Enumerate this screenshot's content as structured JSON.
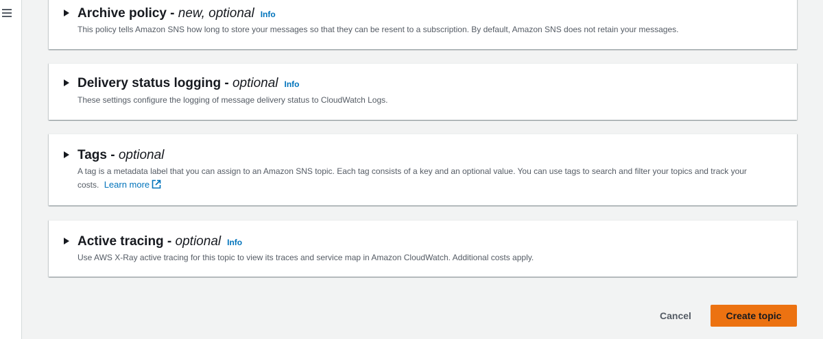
{
  "nav": {
    "menu_icon": "hamburger-menu-icon"
  },
  "sections": [
    {
      "title": "Archive policy",
      "separator": " - ",
      "qualifier": "new, optional",
      "info": "Info",
      "description": "This policy tells Amazon SNS how long to store your messages so that they can be resent to a subscription. By default, Amazon SNS does not retain your messages."
    },
    {
      "title": "Delivery status logging",
      "separator": " - ",
      "qualifier": "optional",
      "info": "Info",
      "description": "These settings configure the logging of message delivery status to CloudWatch Logs."
    },
    {
      "title": "Tags",
      "separator": " - ",
      "qualifier": "optional",
      "description": "A tag is a metadata label that you can assign to an Amazon SNS topic. Each tag consists of a key and an optional value. You can use tags to search and filter your topics and track your costs.",
      "learn_more": "Learn more",
      "learn_more_icon": "external-link-icon"
    },
    {
      "title": "Active tracing",
      "separator": " - ",
      "qualifier": "optional",
      "info": "Info",
      "description": "Use AWS X-Ray active tracing for this topic to view its traces and service map in Amazon CloudWatch. Additional costs apply."
    }
  ],
  "actions": {
    "cancel_label": "Cancel",
    "create_label": "Create topic"
  },
  "colors": {
    "accent": "#ec7211",
    "link": "#0073bb",
    "background": "#f2f3f3"
  }
}
